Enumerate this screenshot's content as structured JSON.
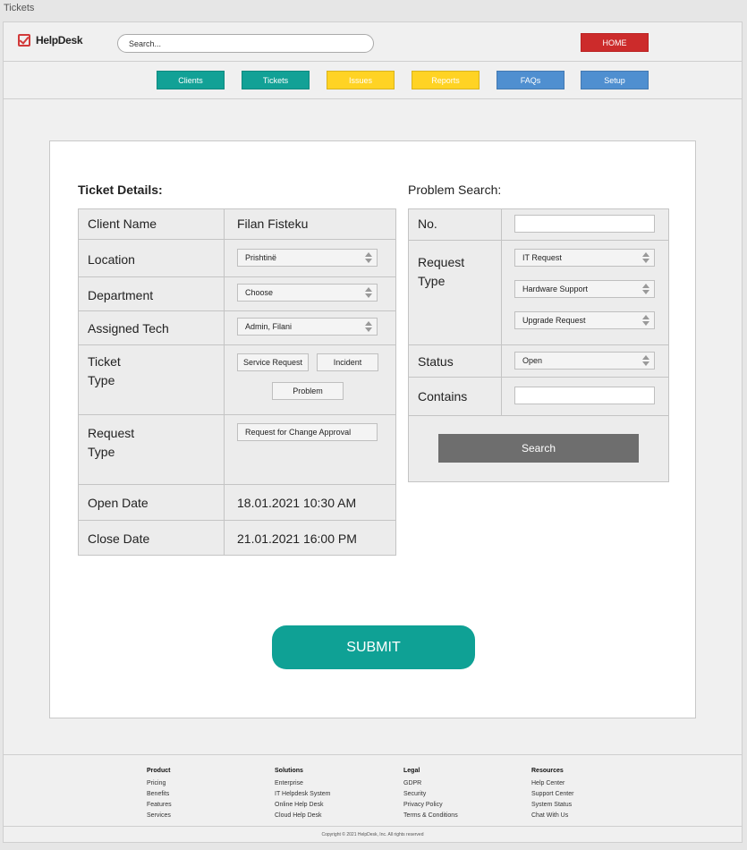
{
  "window": {
    "title": "Tickets"
  },
  "header": {
    "logo_text": "HelpDesk",
    "search_placeholder": "Search...",
    "home_label": "HOME"
  },
  "nav": [
    {
      "label": "Clients",
      "color": "#12a196"
    },
    {
      "label": "Tickets",
      "color": "#12a196"
    },
    {
      "label": "Issues",
      "color": "#ffd324"
    },
    {
      "label": "Reports",
      "color": "#ffd324"
    },
    {
      "label": "FAQs",
      "color": "#4f8fd0"
    },
    {
      "label": "Setup",
      "color": "#4f8fd0"
    }
  ],
  "ticket": {
    "title": "Ticket Details:",
    "client_name_label": "Client Name",
    "client_name_value": "Filan Fisteku",
    "location_label": "Location",
    "location_value": "Prishtinë",
    "department_label": "Department",
    "department_value": "Choose",
    "assigned_tech_label": "Assigned Tech",
    "assigned_tech_value": "Admin, Filani",
    "ticket_type_label_1": "Ticket",
    "ticket_type_label_2": "Type",
    "ticket_type_options": [
      "Service Request",
      "Incident",
      "Problem"
    ],
    "request_type_label_1": "Request",
    "request_type_label_2": "Type",
    "request_type_value": "Request for Change Approval",
    "open_date_label": "Open Date",
    "open_date_value": "18.01.2021 10:30 AM",
    "close_date_label": "Close Date",
    "close_date_value": "21.01.2021 16:00 PM"
  },
  "problem_search": {
    "title": "Problem Search:",
    "no_label": "No.",
    "no_value": "",
    "request_type_label_1": "Request",
    "request_type_label_2": "Type",
    "request_type_values": [
      "IT Request",
      "Hardware Support",
      "Upgrade Request"
    ],
    "status_label": "Status",
    "status_value": "Open",
    "contains_label": "Contains",
    "contains_value": "",
    "search_button": "Search"
  },
  "submit_label": "SUBMIT",
  "footer": {
    "columns": [
      {
        "heading": "Product",
        "links": [
          "Pricing",
          "Benefits",
          "Features",
          "Services"
        ]
      },
      {
        "heading": "Solutions",
        "links": [
          "Enterprise",
          "IT Helpdesk System",
          "Online Help Desk",
          "Cloud Help Desk"
        ]
      },
      {
        "heading": "Legal",
        "links": [
          "GDPR",
          "Security",
          "Privacy Policy",
          "Terms & Conditions"
        ]
      },
      {
        "heading": "Resources",
        "links": [
          "Help Center",
          "Support Center",
          "System Status",
          "Chat With Us"
        ]
      }
    ],
    "copyright": "Copyright © 2021 HelpDesk, Inc. All rights reserved"
  }
}
